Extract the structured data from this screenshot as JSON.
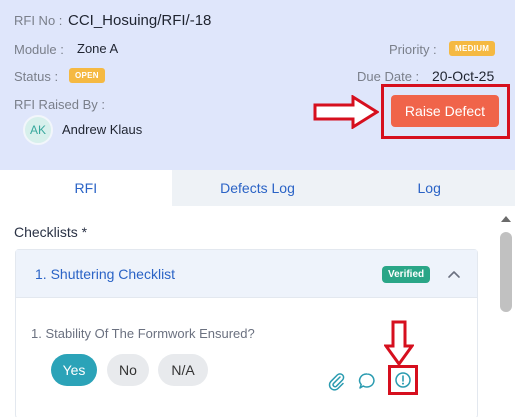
{
  "rfi": {
    "rfi_no_label": "RFI No :",
    "rfi_no": "CCI_Hosuing/RFI/-18",
    "module_label": "Module :",
    "module": "Zone A",
    "priority_label": "Priority :",
    "priority": "MEDIUM",
    "status_label": "Status :",
    "status": "OPEN",
    "due_date_label": "Due Date :",
    "due_date": "20-Oct-25",
    "raised_by_label": "RFI Raised By :",
    "raised_by_initials": "AK",
    "raised_by_name": "Andrew Klaus",
    "raise_defect_label": "Raise Defect"
  },
  "tabs": [
    {
      "label": "RFI",
      "active": true
    },
    {
      "label": "Defects Log",
      "active": false
    },
    {
      "label": "Log",
      "active": false
    }
  ],
  "checklists": {
    "title": "Checklists *",
    "items": [
      {
        "title": "1. Shuttering Checklist",
        "badge": "Verified",
        "questions": [
          {
            "text": "1. Stability Of The Formwork Ensured?",
            "options": [
              "Yes",
              "No",
              "N/A"
            ],
            "selected": "Yes"
          }
        ]
      }
    ]
  },
  "icons": {
    "attachment": "paperclip-icon",
    "comment": "chat-bubble-icon",
    "alert": "alert-circle-icon",
    "collapse": "chevron-up-icon"
  },
  "colors": {
    "header_bg": "#dfe6fb",
    "raise_defect": "#f0644a",
    "highlight": "#d60f1e",
    "verified": "#2aa687",
    "selected_option": "#2ba3b8",
    "badge_warning": "#f5b942",
    "link_blue": "#2a63c6"
  }
}
